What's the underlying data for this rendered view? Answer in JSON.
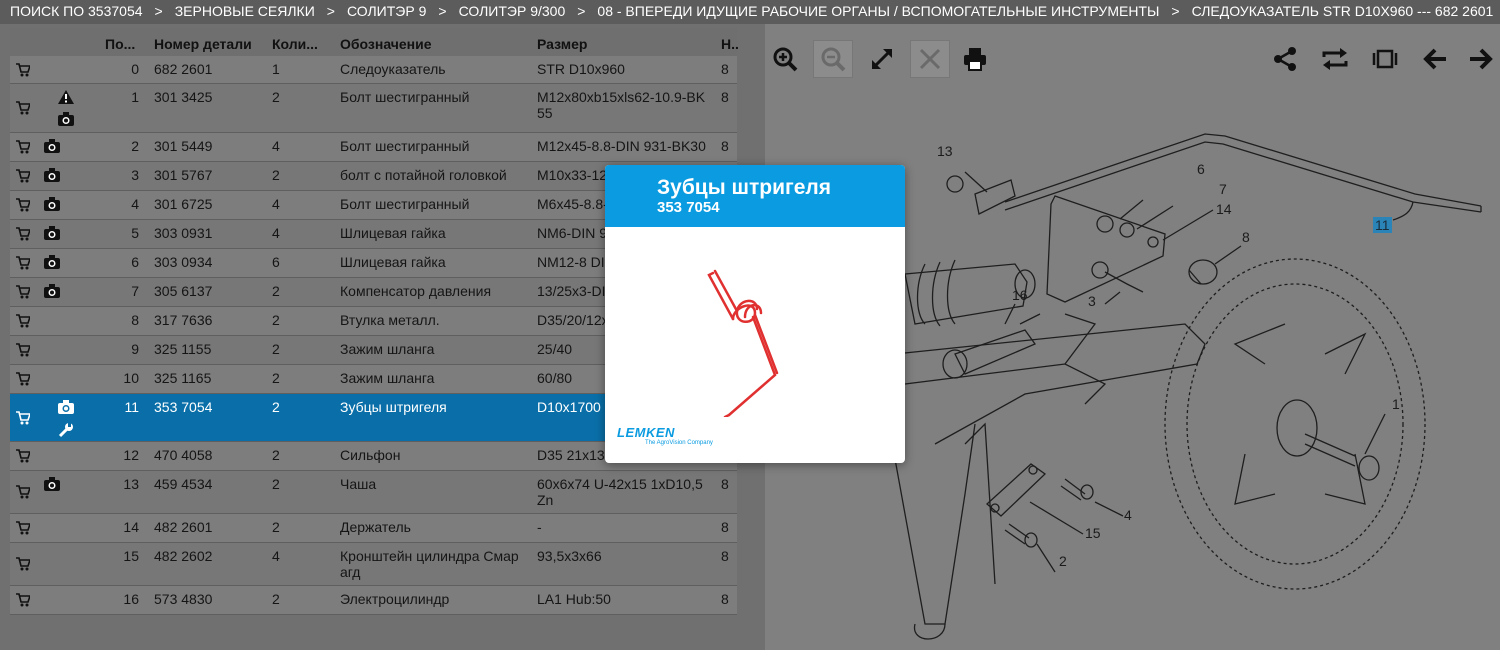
{
  "breadcrumb": [
    "ПОИСК ПО 3537054",
    "ЗЕРНОВЫЕ СЕЯЛКИ",
    "СОЛИТЭР 9",
    "СОЛИТЭР 9/300",
    "08 - ВПЕРЕДИ ИДУЩИЕ РАБОЧИЕ ОРГАНЫ / ВСПОМОГАТЕЛЬНЫЕ ИНСТРУМЕНТЫ",
    "СЛЕДОУКАЗАТЕЛЬ STR D10X960 --- 682 2601"
  ],
  "breadcrumb_sep": ">",
  "table": {
    "headers": {
      "pos": "По...",
      "num": "Номер детали",
      "qty": "Коли...",
      "name": "Обозначение",
      "size": "Размер",
      "n": "Н.."
    },
    "rows": [
      {
        "pos": "0",
        "num": "682 2601",
        "qty": "1",
        "name": "Следоуказатель",
        "size": "STR D10x960",
        "n": "8",
        "icons": []
      },
      {
        "pos": "1",
        "num": "301 3425",
        "qty": "2",
        "name": "Болт шестигранный",
        "size": "M12x80xb15xls62-10.9-BK 55",
        "n": "8",
        "icons": [
          "warning",
          "camera"
        ]
      },
      {
        "pos": "2",
        "num": "301 5449",
        "qty": "4",
        "name": "Болт шестигранный",
        "size": "M12x45-8.8-DIN 931-BK30",
        "n": "8",
        "icons": [
          "camera"
        ]
      },
      {
        "pos": "3",
        "num": "301 5767",
        "qty": "2",
        "name": "болт с потайной головкой",
        "size": "M10x33-12",
        "n": "",
        "icons": [
          "camera"
        ]
      },
      {
        "pos": "4",
        "num": "301 6725",
        "qty": "4",
        "name": "Болт шестигранный",
        "size": "M6x45-8.8-",
        "n": "",
        "icons": [
          "camera"
        ]
      },
      {
        "pos": "5",
        "num": "303 0931",
        "qty": "4",
        "name": "Шлицевая гайка",
        "size": "NM6-DIN 9",
        "n": "",
        "icons": [
          "camera"
        ]
      },
      {
        "pos": "6",
        "num": "303 0934",
        "qty": "6",
        "name": "Шлицевая гайка",
        "size": "NM12-8 DI",
        "n": "",
        "icons": [
          "camera"
        ]
      },
      {
        "pos": "7",
        "num": "305 6137",
        "qty": "2",
        "name": "Компенсатор давления",
        "size": "13/25x3-DI",
        "n": "",
        "icons": [
          "camera"
        ]
      },
      {
        "pos": "8",
        "num": "317 7636",
        "qty": "2",
        "name": "Втулка металл.",
        "size": "D35/20/12x",
        "n": "",
        "icons": []
      },
      {
        "pos": "9",
        "num": "325 1155",
        "qty": "2",
        "name": "Зажим шланга",
        "size": "25/40",
        "n": "",
        "icons": []
      },
      {
        "pos": "10",
        "num": "325 1165",
        "qty": "2",
        "name": "Зажим шланга",
        "size": "60/80",
        "n": "",
        "icons": []
      },
      {
        "pos": "11",
        "num": "353 7054",
        "qty": "2",
        "name": "Зубцы штригеля",
        "size": "D10x1700",
        "n": "",
        "icons": [
          "camera",
          "wrench"
        ],
        "selected": true
      },
      {
        "pos": "12",
        "num": "470 4058",
        "qty": "2",
        "name": "Сильфон",
        "size": "D35 21x13",
        "n": "",
        "icons": []
      },
      {
        "pos": "13",
        "num": "459 4534",
        "qty": "2",
        "name": "Чаша",
        "size": "60x6x74 U-42x15 1xD10,5 Zn",
        "n": "8",
        "icons": [
          "camera"
        ]
      },
      {
        "pos": "14",
        "num": "482 2601",
        "qty": "2",
        "name": "Держатель",
        "size": "-",
        "n": "8",
        "icons": []
      },
      {
        "pos": "15",
        "num": "482 2602",
        "qty": "4",
        "name": "Кронштейн цилиндра Смар агд",
        "size": "93,5x3x66",
        "n": "8",
        "icons": []
      },
      {
        "pos": "16",
        "num": "573 4830",
        "qty": "2",
        "name": "Электроцилиндр",
        "size": "LA1 Hub:50",
        "n": "8",
        "icons": []
      }
    ]
  },
  "toolbar": {
    "left": [
      "zoom-in-icon",
      "zoom-out-icon",
      "fullscreen-icon",
      "fit-icon",
      "print-icon"
    ],
    "right": [
      "share-icon",
      "swap-icon",
      "carousel-icon",
      "arrow-left-icon",
      "arrow-right-icon"
    ]
  },
  "diagram": {
    "labels": [
      "13",
      "6",
      "7",
      "14",
      "8",
      "3",
      "16",
      "11",
      "1",
      "4",
      "15",
      "2"
    ],
    "highlight": "11"
  },
  "popup": {
    "title": "Зубцы штригеля",
    "part_number": "353 7054",
    "brand": "LEMKEN",
    "brand_sub": "The AgroVision Company"
  },
  "colors": {
    "accent": "#0a9be0",
    "selected_row": "#0a6fa8",
    "tine_red": "#e03030"
  }
}
